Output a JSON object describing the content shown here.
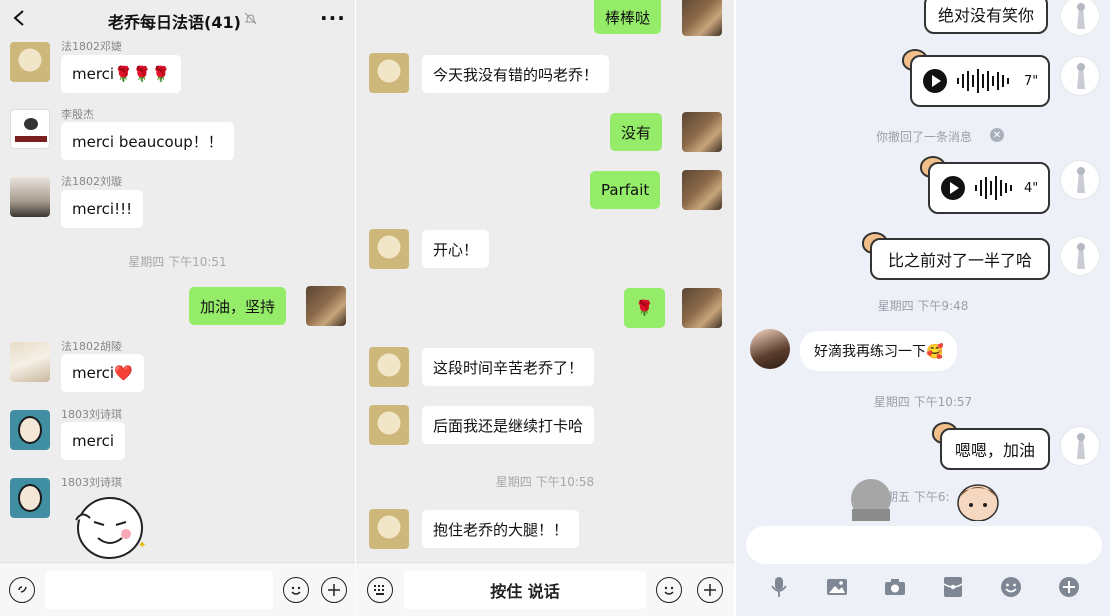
{
  "left": {
    "title": "老乔每日法语(41)",
    "back_icon": "chevron-left-icon",
    "more_icon": "more-dots-icon",
    "mute_icon": "bell-off-icon",
    "messages": [
      {
        "sender": "法1802邓婕",
        "text": "merci🌹🌹🌹"
      },
      {
        "sender": "李殷杰",
        "text": "merci beaucoup！！"
      },
      {
        "sender": "法1802刘璇",
        "text": "merci!!!"
      },
      {
        "sender": "法1802胡陵",
        "text": "merci❤️"
      },
      {
        "sender": "1803刘诗琪",
        "text": "merci"
      },
      {
        "sender": "1803刘诗琪",
        "text": ""
      }
    ],
    "timestamp": "星期四 下午10:51",
    "my_message": "加油，坚持",
    "voice_icon": "voice-icon",
    "emoji_icon": "emoji-icon",
    "plus_icon": "plus-icon"
  },
  "middle": {
    "messages_me": [
      "棒棒哒",
      "没有",
      "Parfait",
      "🌹"
    ],
    "messages_other": [
      "今天我没有错的吗老乔！",
      "开心！",
      "这段时间辛苦老乔了！",
      "后面我还是继续打卡哈",
      "抱住老乔的大腿！！"
    ],
    "timestamp": "星期四 下午10:58",
    "hold_to_talk": "按住 说话",
    "keyboard_icon": "keyboard-icon",
    "emoji_icon": "emoji-icon",
    "plus_icon": "plus-icon"
  },
  "right": {
    "bubble_top": "绝对没有笑你",
    "voice1_duration": "7\"",
    "recall_tip": "你撤回了一条消息",
    "voice2_duration": "4\"",
    "bubble_half": "比之前对了一半了哈",
    "time1": "星期四 下午9:48",
    "incoming": "好滴我再练习一下🥰",
    "time2": "星期四 下午10:57",
    "bubble_cheer": "嗯嗯，加油",
    "time3": "期五 下午6:",
    "toolbar_icons": [
      "mic-icon",
      "image-icon",
      "camera-icon",
      "red-packet-icon",
      "emoji-icon",
      "plus-icon"
    ]
  }
}
